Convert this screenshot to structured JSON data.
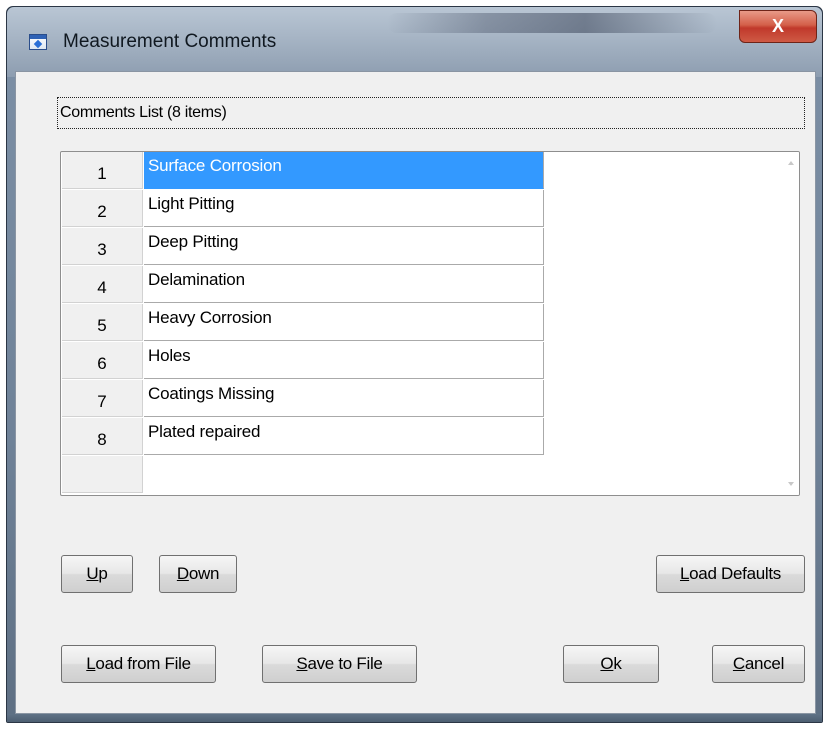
{
  "window": {
    "title": "Measurement Comments",
    "close_label": "X"
  },
  "group": {
    "label": "Comments List (8 items)"
  },
  "comments": [
    {
      "index": "1",
      "text": "Surface Corrosion",
      "selected": true
    },
    {
      "index": "2",
      "text": "Light Pitting"
    },
    {
      "index": "3",
      "text": "Deep Pitting"
    },
    {
      "index": "4",
      "text": "Delamination"
    },
    {
      "index": "5",
      "text": "Heavy Corrosion"
    },
    {
      "index": "6",
      "text": "Holes"
    },
    {
      "index": "7",
      "text": "Coatings Missing"
    },
    {
      "index": "8",
      "text": "Plated repaired"
    }
  ],
  "buttons": {
    "up": {
      "key": "U",
      "rest": "p"
    },
    "down": {
      "key": "D",
      "rest": "own"
    },
    "load_defaults": {
      "key": "L",
      "rest": "oad Defaults"
    },
    "load_file": {
      "key": "L",
      "rest": "oad from File"
    },
    "save_file": {
      "key": "S",
      "rest": "ave to File"
    },
    "ok": {
      "key": "O",
      "rest": "k"
    },
    "cancel": {
      "key": "C",
      "rest": "ancel"
    }
  },
  "colors": {
    "selection": "#3399ff",
    "close_button": "#c0392b",
    "dialog_background": "#f0f0f0"
  }
}
